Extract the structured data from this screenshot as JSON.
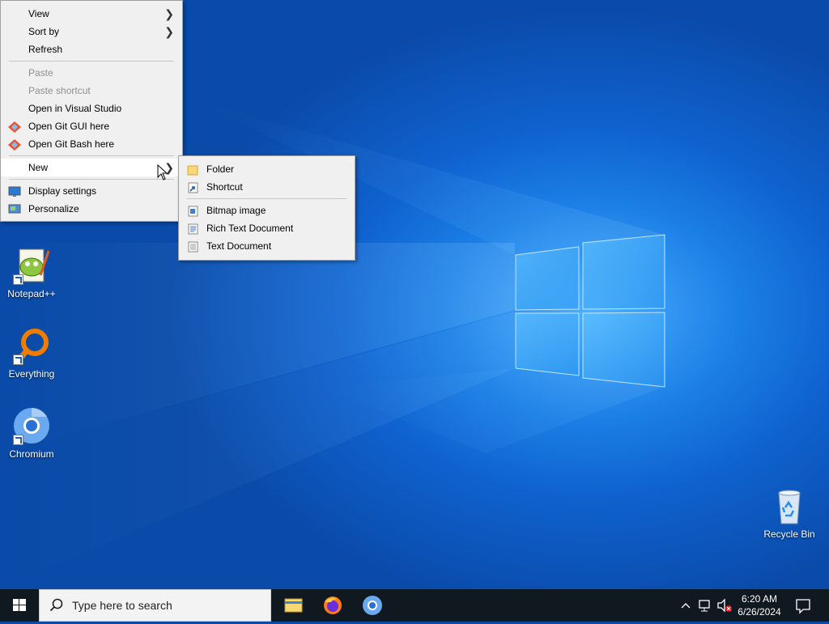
{
  "desktop": {
    "icons": [
      {
        "label": "Notepad++",
        "icon": "notepad-plus-plus-icon"
      },
      {
        "label": "Everything",
        "icon": "everything-search-icon"
      },
      {
        "label": "Chromium",
        "icon": "chromium-icon"
      },
      {
        "label": "Recycle Bin",
        "icon": "recycle-bin-icon"
      }
    ]
  },
  "context_menu": {
    "items": [
      {
        "label": "View",
        "submenu": true
      },
      {
        "label": "Sort by",
        "submenu": true
      },
      {
        "label": "Refresh"
      },
      {
        "label": "Paste",
        "disabled": true
      },
      {
        "label": "Paste shortcut",
        "disabled": true
      },
      {
        "label": "Open in Visual Studio"
      },
      {
        "label": "Open Git GUI here",
        "icon": "git-icon"
      },
      {
        "label": "Open Git Bash here",
        "icon": "git-icon"
      },
      {
        "label": "New",
        "submenu": true,
        "highlighted": true
      },
      {
        "label": "Display settings",
        "icon": "display-icon"
      },
      {
        "label": "Personalize",
        "icon": "personalize-icon"
      }
    ]
  },
  "new_submenu": {
    "items": [
      {
        "label": "Folder",
        "icon": "folder-icon"
      },
      {
        "label": "Shortcut",
        "icon": "shortcut-icon"
      },
      {
        "label": "Bitmap image",
        "icon": "bitmap-icon"
      },
      {
        "label": "Rich Text Document",
        "icon": "rtf-document-icon"
      },
      {
        "label": "Text Document",
        "icon": "text-document-icon"
      }
    ]
  },
  "taskbar": {
    "search_placeholder": "Type here to search",
    "apps": [
      "file-explorer-icon",
      "firefox-icon",
      "chromium-icon"
    ],
    "tray": [
      "chevron-up-icon",
      "network-icon",
      "volume-muted-icon"
    ],
    "clock": {
      "time": "6:20 AM",
      "date": "6/26/2024"
    }
  },
  "colors": {
    "wallpaper_base": "#0f62cf",
    "menu_bg": "#f0f0f0",
    "taskbar_bg": "#101820"
  }
}
